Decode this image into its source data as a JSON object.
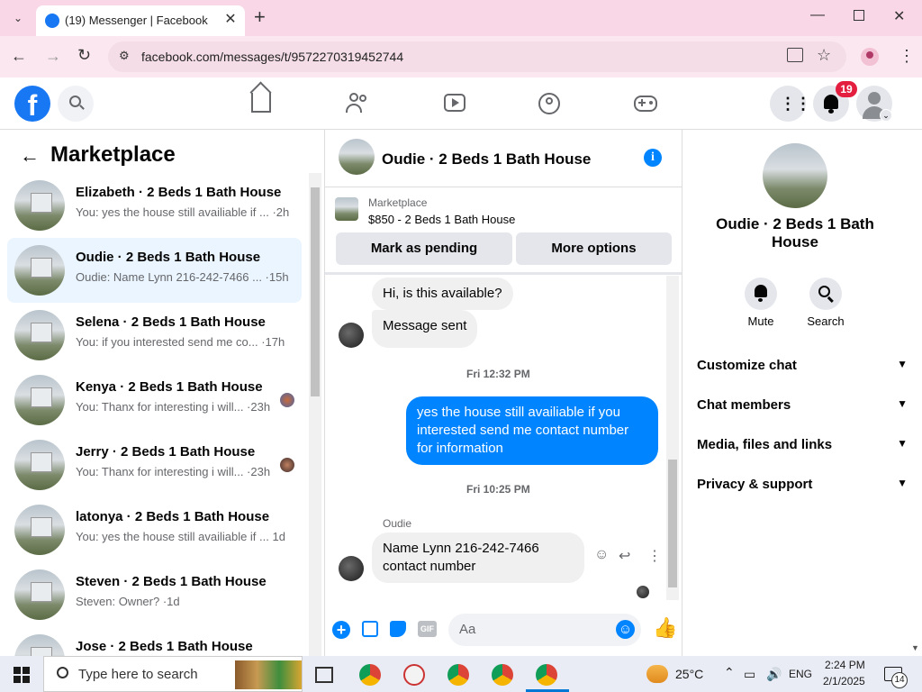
{
  "browser": {
    "tab_title": "(19) Messenger | Facebook",
    "url": "facebook.com/messages/t/9572270319452744"
  },
  "fb_header": {
    "notification_count": "19"
  },
  "left": {
    "title": "Marketplace",
    "conversations": [
      {
        "name": "Elizabeth · 2 Beds 1 Bath House",
        "snippet": "You: yes the house still availiable if ... ·2h"
      },
      {
        "name": "Oudie · 2 Beds 1 Bath House",
        "snippet": "Oudie: Name Lynn 216-242-7466 ... ·15h"
      },
      {
        "name": "Selena · 2 Beds 1 Bath House",
        "snippet": "You: if you interested send me co... ·17h"
      },
      {
        "name": "Kenya · 2 Beds 1 Bath House",
        "snippet": "You: Thanx for interesting i will... ·23h"
      },
      {
        "name": "Jerry · 2 Beds 1 Bath House",
        "snippet": "You: Thanx for interesting i will... ·23h"
      },
      {
        "name": "latonya · 2 Beds 1 Bath House",
        "snippet": "You: yes the house still availiable if ...  1d"
      },
      {
        "name": "Steven · 2 Beds 1 Bath House",
        "snippet": "Steven: Owner? ·1d"
      },
      {
        "name": "Jose · 2 Beds 1 Bath House",
        "snippet": ""
      }
    ]
  },
  "chat": {
    "title": "Oudie · 2 Beds 1 Bath House",
    "listing_source": "Marketplace",
    "listing_text": "$850 - 2 Beds 1 Bath House",
    "mark_pending": "Mark as pending",
    "more_options": "More options",
    "messages": {
      "m1": "Hi, is this available?",
      "m2": "Message sent",
      "ts1": "Fri 12:32 PM",
      "m3": "yes the house still availiable if you interested send me contact number for information",
      "ts2": "Fri 10:25 PM",
      "sender": "Oudie",
      "m4": "Name Lynn 216-242-7466 contact number"
    },
    "composer_placeholder": "Aa"
  },
  "right": {
    "name": "Oudie · 2 Beds 1 Bath House",
    "mute": "Mute",
    "search": "Search",
    "sections": [
      "Customize chat",
      "Chat members",
      "Media, files and links",
      "Privacy & support"
    ]
  },
  "taskbar": {
    "search_placeholder": "Type here to search",
    "temp": "25°C",
    "lang": "ENG",
    "time": "2:24 PM",
    "date": "2/1/2025",
    "notif": "14"
  },
  "colors": {
    "fb_blue": "#1877f2",
    "msg_blue": "#0084ff",
    "badge_red": "#e41e3f",
    "tab_pink": "#f9d7e6"
  }
}
